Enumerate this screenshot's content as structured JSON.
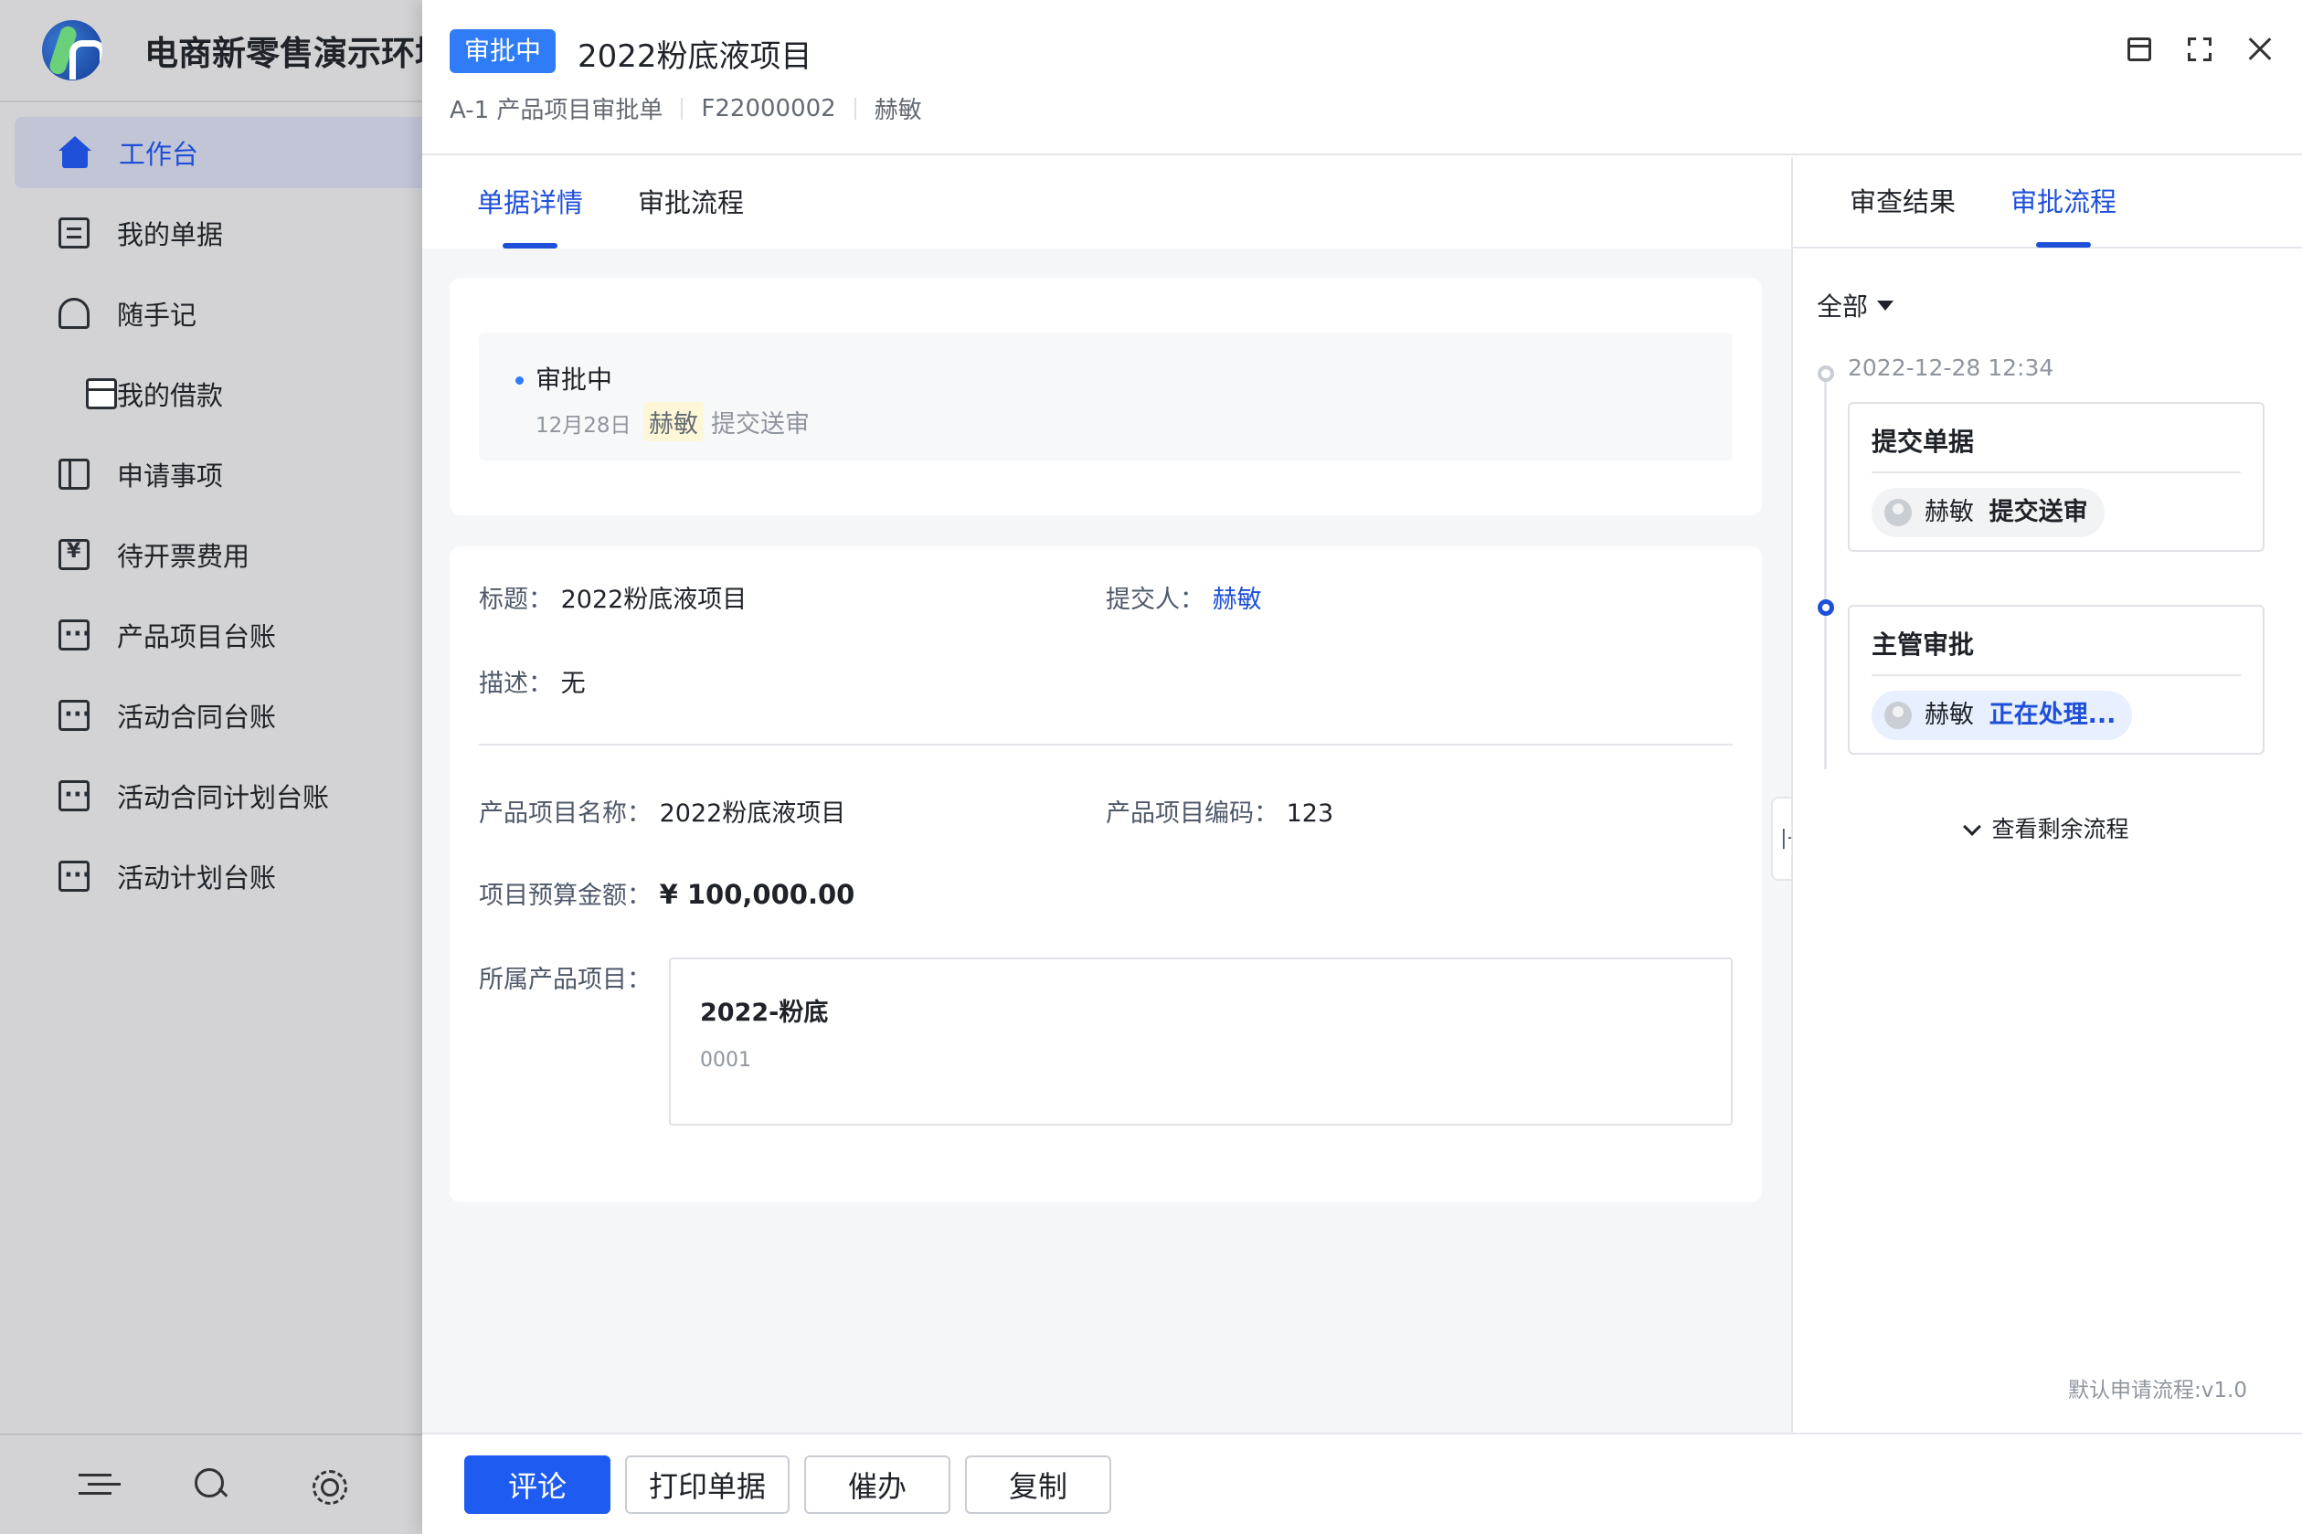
{
  "sidebar": {
    "app_title": "电商新零售演示环境",
    "items": [
      {
        "label": "工作台",
        "icon": "home-icon",
        "active": true
      },
      {
        "label": "我的单据",
        "icon": "document-icon"
      },
      {
        "label": "随手记",
        "icon": "note-icon"
      },
      {
        "label": "我的借款",
        "icon": "wallet-icon"
      },
      {
        "label": "申请事项",
        "icon": "book-icon"
      },
      {
        "label": "待开票费用",
        "icon": "invoice-icon"
      },
      {
        "label": "产品项目台账",
        "icon": "ledger-icon"
      },
      {
        "label": "活动合同台账",
        "icon": "ledger-icon"
      },
      {
        "label": "活动合同计划台账",
        "icon": "ledger-icon"
      },
      {
        "label": "活动计划台账",
        "icon": "ledger-icon"
      }
    ],
    "footer_icons": [
      "collapse-icon",
      "search-icon",
      "gear-icon"
    ]
  },
  "header": {
    "status": "审批中",
    "title": "2022粉底液项目",
    "form_type": "A-1 产品项目审批单",
    "form_no": "F22000002",
    "owner": "赫敏"
  },
  "main": {
    "tabs": [
      {
        "label": "单据详情",
        "active": true
      },
      {
        "label": "审批流程"
      }
    ],
    "timeline": {
      "status": "审批中",
      "date": "12月28日",
      "person": "赫敏",
      "action": "提交送审"
    },
    "fields": {
      "title_label": "标题：",
      "title_value": "2022粉底液项目",
      "submitter_label": "提交人：",
      "submitter_value": "赫敏",
      "desc_label": "描述：",
      "desc_value": "无",
      "product_name_label": "产品项目名称：",
      "product_name_value": "2022粉底液项目",
      "product_code_label": "产品项目编码：",
      "product_code_value": "123",
      "budget_label": "项目预算金额：",
      "budget_value": "¥ 100,000.00",
      "parent_label": "所属产品项目："
    },
    "parent_project": {
      "name": "2022-粉底",
      "code": "0001"
    }
  },
  "right_panel": {
    "tabs": [
      {
        "label": "审查结果"
      },
      {
        "label": "审批流程",
        "active": true
      }
    ],
    "filter": "全部",
    "time": "2022-12-28 12:34",
    "steps": [
      {
        "title": "提交单据",
        "person": "赫敏",
        "action": "提交送审",
        "state": "done"
      },
      {
        "title": "主管审批",
        "person": "赫敏",
        "action": "正在处理...",
        "state": "processing"
      }
    ],
    "more": "查看剩余流程",
    "version": "默认申请流程:v1.0"
  },
  "footer": {
    "buttons": [
      "评论",
      "打印单据",
      "催办",
      "复制"
    ]
  },
  "colors": {
    "accent": "#1e5bf0",
    "status_tag": "#2f7cf6",
    "link": "#1e4fd8"
  }
}
